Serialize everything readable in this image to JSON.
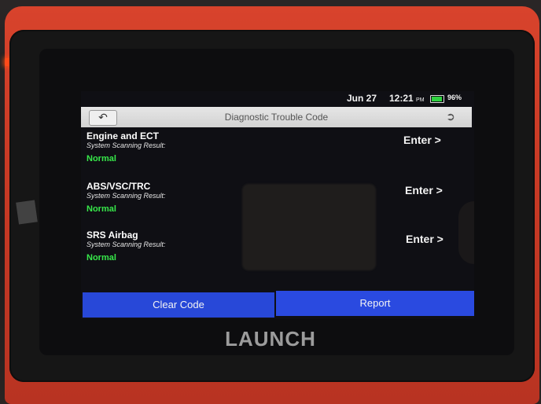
{
  "status": {
    "date": "Jun 27",
    "time": "12:21",
    "ampm": "PM",
    "battery_percent": "96%",
    "battery_level": 0.96
  },
  "header": {
    "title": "Diagnostic Trouble Code",
    "back_icon": "back-arrow-icon",
    "exit_icon": "exit-icon"
  },
  "systems": [
    {
      "name": "Engine and ECT",
      "subtitle": "System Scanning Result:",
      "status": "Normal",
      "action": "Enter >"
    },
    {
      "name": "ABS/VSC/TRC",
      "subtitle": "System Scanning Result:",
      "status": "Normal",
      "action": "Enter >"
    },
    {
      "name": "SRS Airbag",
      "subtitle": "System Scanning Result:",
      "status": "Normal",
      "action": "Enter >"
    }
  ],
  "footer": {
    "clear_label": "Clear Code",
    "report_label": "Report"
  },
  "device": {
    "brand": "LAUNCH"
  },
  "colors": {
    "button_blue": "#2a4ae0",
    "status_green": "#37e84a",
    "device_red": "#c93a25"
  }
}
